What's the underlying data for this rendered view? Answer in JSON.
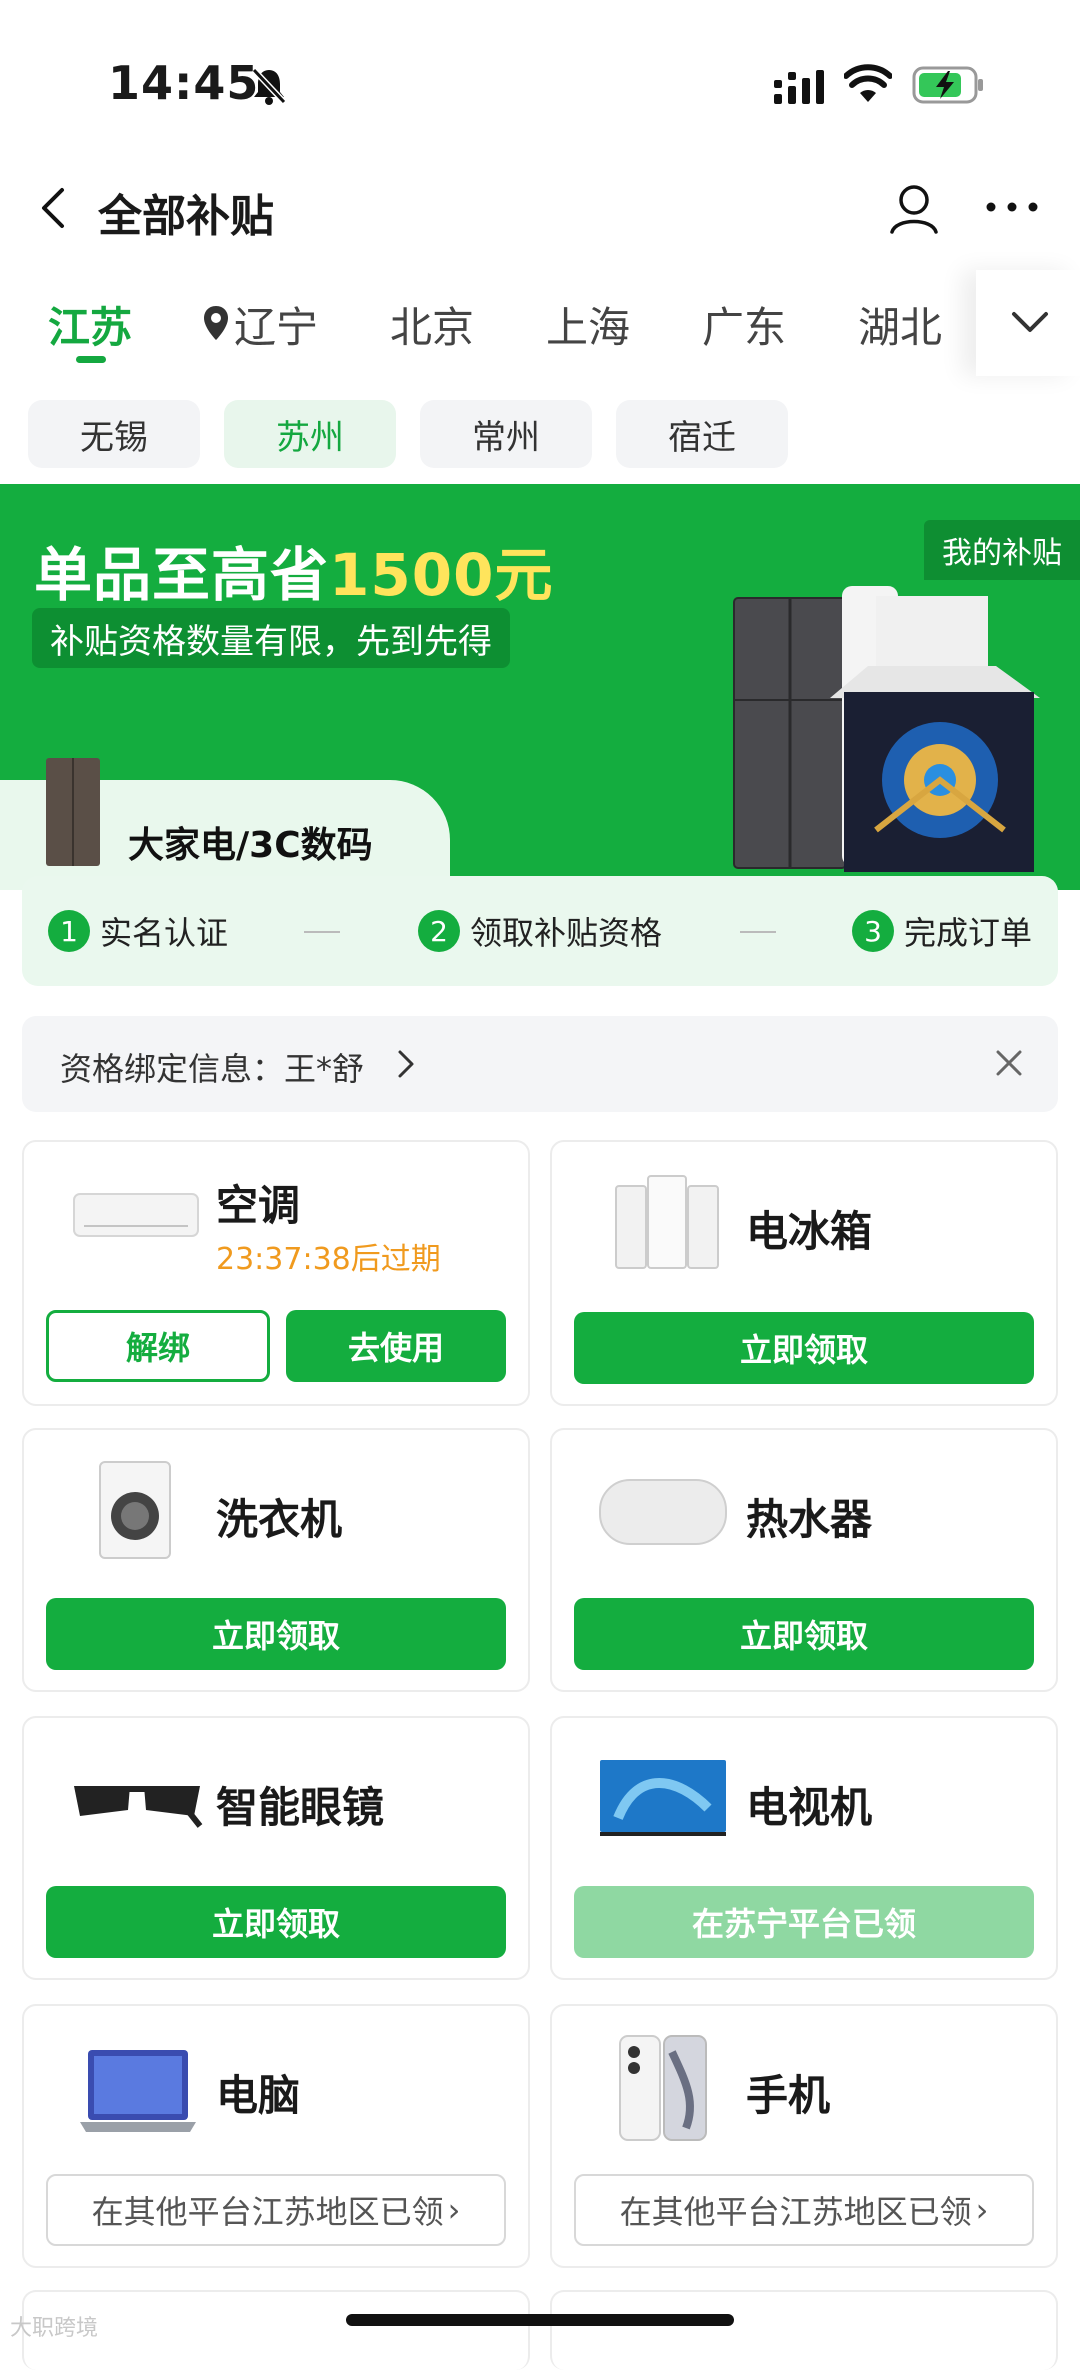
{
  "status_bar": {
    "time": "14:45"
  },
  "nav": {
    "title": "全部补贴"
  },
  "region_tabs": [
    {
      "label": "江苏",
      "active": true
    },
    {
      "label": "辽宁",
      "location": true
    },
    {
      "label": "北京"
    },
    {
      "label": "上海"
    },
    {
      "label": "广东"
    },
    {
      "label": "湖北"
    }
  ],
  "cities": [
    {
      "label": "无锡"
    },
    {
      "label": "苏州",
      "active": true
    },
    {
      "label": "常州"
    },
    {
      "label": "宿迁"
    }
  ],
  "banner": {
    "title_prefix": "单品至高省",
    "title_amount": "1500元",
    "subtitle": "补贴资格数量有限，先到先得",
    "my_subsidy": "我的补贴",
    "category": "大家电/3C数码"
  },
  "steps": [
    {
      "num": "1",
      "label": "实名认证"
    },
    {
      "num": "2",
      "label": "领取补贴资格"
    },
    {
      "num": "3",
      "label": "完成订单"
    }
  ],
  "binding": {
    "label": "资格绑定信息：王*舒"
  },
  "products": [
    {
      "name": "空调",
      "expire": "23:37:38后过期",
      "btn_unbind": "解绑",
      "btn_use": "去使用"
    },
    {
      "name": "电冰箱",
      "btn": "立即领取"
    },
    {
      "name": "洗衣机",
      "btn": "立即领取"
    },
    {
      "name": "热水器",
      "btn": "立即领取"
    },
    {
      "name": "智能眼镜",
      "btn": "立即领取"
    },
    {
      "name": "电视机",
      "btn": "在苏宁平台已领"
    },
    {
      "name": "电脑",
      "btn": "在其他平台江苏地区已领"
    },
    {
      "name": "手机",
      "btn": "在其他平台江苏地区已领"
    }
  ],
  "watermark": "大职跨境",
  "colors": {
    "brand_green": "#14ad3f",
    "expire_orange": "#f09a1e",
    "faded_green": "#8fd8a2"
  }
}
